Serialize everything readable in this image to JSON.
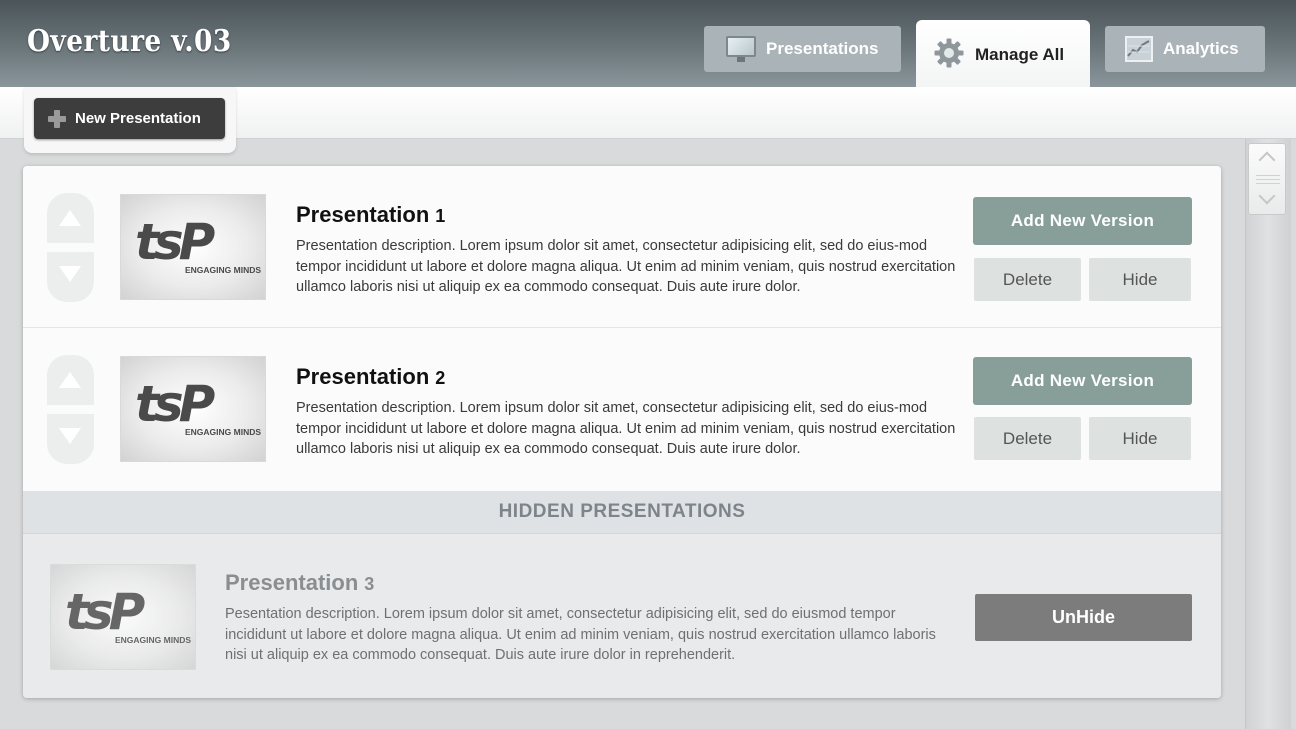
{
  "app": {
    "title": "Overture  v.03"
  },
  "nav": {
    "tabs": [
      {
        "label": "Presentations",
        "icon": "monitor-icon",
        "active": false
      },
      {
        "label": "Manage All",
        "icon": "gear-icon",
        "active": true
      },
      {
        "label": "Analytics",
        "icon": "chart-icon",
        "active": false
      }
    ]
  },
  "toolbar": {
    "new_label": "New Presentation",
    "new_icon": "plus-icon"
  },
  "presentations": [
    {
      "title": "Presentation",
      "number": "1",
      "description": "Presentation description. Lorem ipsum dolor sit amet, consectetur adipisicing elit, sed do eius-mod tempor incididunt ut labore et dolore magna aliqua. Ut enim ad minim veniam, quis nostrud exercitation ullamco laboris nisi ut aliquip ex ea commodo consequat. Duis aute irure dolor.",
      "logo": "tsP",
      "logo_tagline": "ENGAGING MINDS",
      "add_version_label": "Add New Version",
      "delete_label": "Delete",
      "hide_label": "Hide"
    },
    {
      "title": "Presentation",
      "number": "2",
      "description": "Presentation description. Lorem ipsum dolor sit amet, consectetur adipisicing elit, sed do eius-mod tempor incididunt ut labore et dolore magna aliqua. Ut enim ad minim veniam, quis nostrud exercitation ullamco laboris nisi ut aliquip ex ea commodo consequat. Duis aute irure dolor.",
      "logo": "tsP",
      "logo_tagline": "ENGAGING MINDS",
      "add_version_label": "Add New Version",
      "delete_label": "Delete",
      "hide_label": "Hide"
    }
  ],
  "hidden_section": {
    "heading": "HIDDEN PRESENTATIONS",
    "items": [
      {
        "title": "Presentation",
        "number": "3",
        "description": "Pesentation description. Lorem ipsum dolor sit amet, consectetur adipisicing elit, sed do eiusmod tempor incididunt ut labore et dolore magna aliqua. Ut enim ad minim veniam, quis nostrud exercitation ullamco laboris nisi ut aliquip ex ea commodo consequat. Duis aute irure dolor in reprehenderit.",
        "logo": "tsP",
        "logo_tagline": "ENGAGING MINDS",
        "unhide_label": "UnHide"
      }
    ]
  },
  "colors": {
    "header_dark": "#4a5459",
    "accent_button": "#879e99",
    "new_button": "#3d3d3d",
    "unhide_button": "#7c7c7c",
    "hidden_bar_text": "#7d858a"
  }
}
